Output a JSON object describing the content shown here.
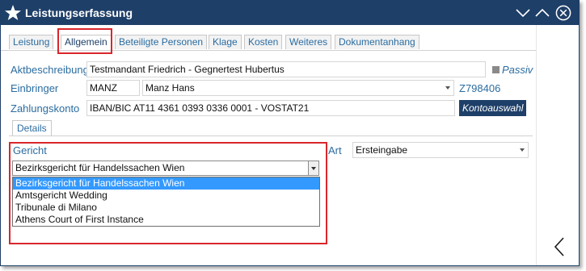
{
  "window": {
    "title": "Leistungserfassung",
    "icons": [
      "star-icon",
      "minimize-chevron-icon",
      "maximize-chevron-icon",
      "close-icon",
      "back-arrow-icon"
    ],
    "accent_color": "#1e3f68"
  },
  "tabs": [
    {
      "label": "Leistung"
    },
    {
      "label": "Allgemein",
      "active": true
    },
    {
      "label": "Beteiligte Personen"
    },
    {
      "label": "Klage"
    },
    {
      "label": "Kosten"
    },
    {
      "label": "Weiteres"
    },
    {
      "label": "Dokumentanhang"
    }
  ],
  "form": {
    "aktbeschreibung": {
      "label": "Aktbeschreibung",
      "value": "Testmandant Friedrich - Gegnertest Hubertus"
    },
    "passiv_label": "Passiv",
    "einbringer": {
      "label": "Einbringer",
      "code": "MANZ",
      "name": "Manz Hans",
      "link": "Z798406"
    },
    "zahlungskonto": {
      "label": "Zahlungskonto",
      "value": "IBAN/BIC AT11 4361 0393 0336 0001 - VOSTAT21",
      "button": "Kontoauswahl"
    }
  },
  "subtabs": [
    {
      "label": "Details",
      "active": true
    }
  ],
  "details": {
    "gericht": {
      "label": "Gericht",
      "selected": "Bezirksgericht für Handelssachen Wien",
      "options": [
        "Bezirksgericht für Handelssachen Wien",
        "Amtsgericht Wedding",
        "Tribunale di Milano",
        "Athens Court of First Instance"
      ]
    },
    "art": {
      "label": "Art",
      "value": "Ersteingabe"
    }
  },
  "highlight_color": "#d9262c"
}
